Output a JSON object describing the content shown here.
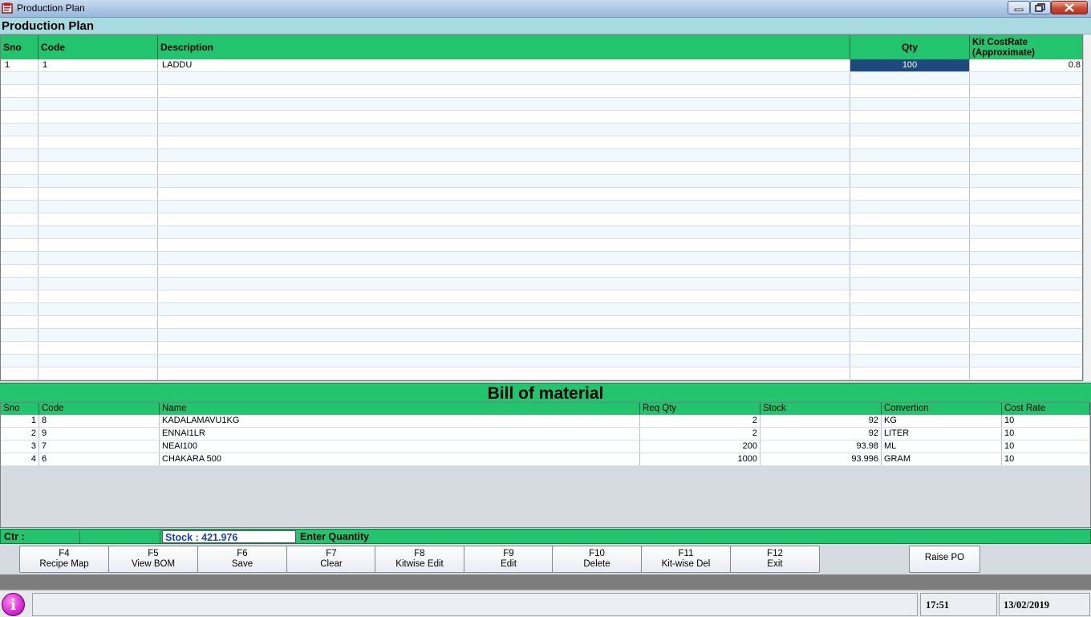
{
  "window": {
    "title": "Production Plan"
  },
  "section_title": "Production Plan",
  "upper_grid": {
    "columns": [
      "Sno",
      "Code",
      "Description",
      "Qty",
      "Kit CostRate\n(Approximate)"
    ],
    "rows": [
      {
        "sno": "1",
        "code": "1",
        "description": "LADDU",
        "qty": "100",
        "kit_cost_rate": "0.8"
      }
    ]
  },
  "bom": {
    "title": "Bill of material",
    "columns": [
      "Sno",
      "Code",
      "Name",
      "Req Qty",
      "Stock",
      "Convertion",
      "Cost Rate"
    ],
    "rows": [
      {
        "sno": "1",
        "code": "8",
        "name": "KADALAMAVU1KG",
        "req_qty": "2",
        "stock": "92",
        "conversion": "KG",
        "cost_rate": "10"
      },
      {
        "sno": "2",
        "code": "9",
        "name": "ENNAI1LR",
        "req_qty": "2",
        "stock": "92",
        "conversion": "LITER",
        "cost_rate": "10"
      },
      {
        "sno": "3",
        "code": "7",
        "name": "NEAI100",
        "req_qty": "200",
        "stock": "93.98",
        "conversion": "ML",
        "cost_rate": "10"
      },
      {
        "sno": "4",
        "code": "6",
        "name": "CHAKARA 500",
        "req_qty": "1000",
        "stock": "93.996",
        "conversion": "GRAM",
        "cost_rate": "10"
      }
    ]
  },
  "status": {
    "ctr_label": "Ctr :",
    "stock_text": "Stock : 421.976",
    "hint": "Enter Quantity"
  },
  "fkeys": [
    {
      "key": "F4",
      "label": "Recipe Map"
    },
    {
      "key": "F5",
      "label": "View BOM"
    },
    {
      "key": "F6",
      "label": "Save"
    },
    {
      "key": "F7",
      "label": "Clear"
    },
    {
      "key": "F8",
      "label": "Kitwise Edit"
    },
    {
      "key": "F9",
      "label": "Edit"
    },
    {
      "key": "F10",
      "label": "Delete"
    },
    {
      "key": "F11",
      "label": "Kit-wise Del"
    },
    {
      "key": "F12",
      "label": "Exit"
    }
  ],
  "raise_po_label": "Raise PO",
  "bottom": {
    "time": "17:51",
    "date": "13/02/2019",
    "info_glyph": "i"
  },
  "icons": {
    "app": "production-plan-app-icon",
    "info": "info-icon"
  }
}
